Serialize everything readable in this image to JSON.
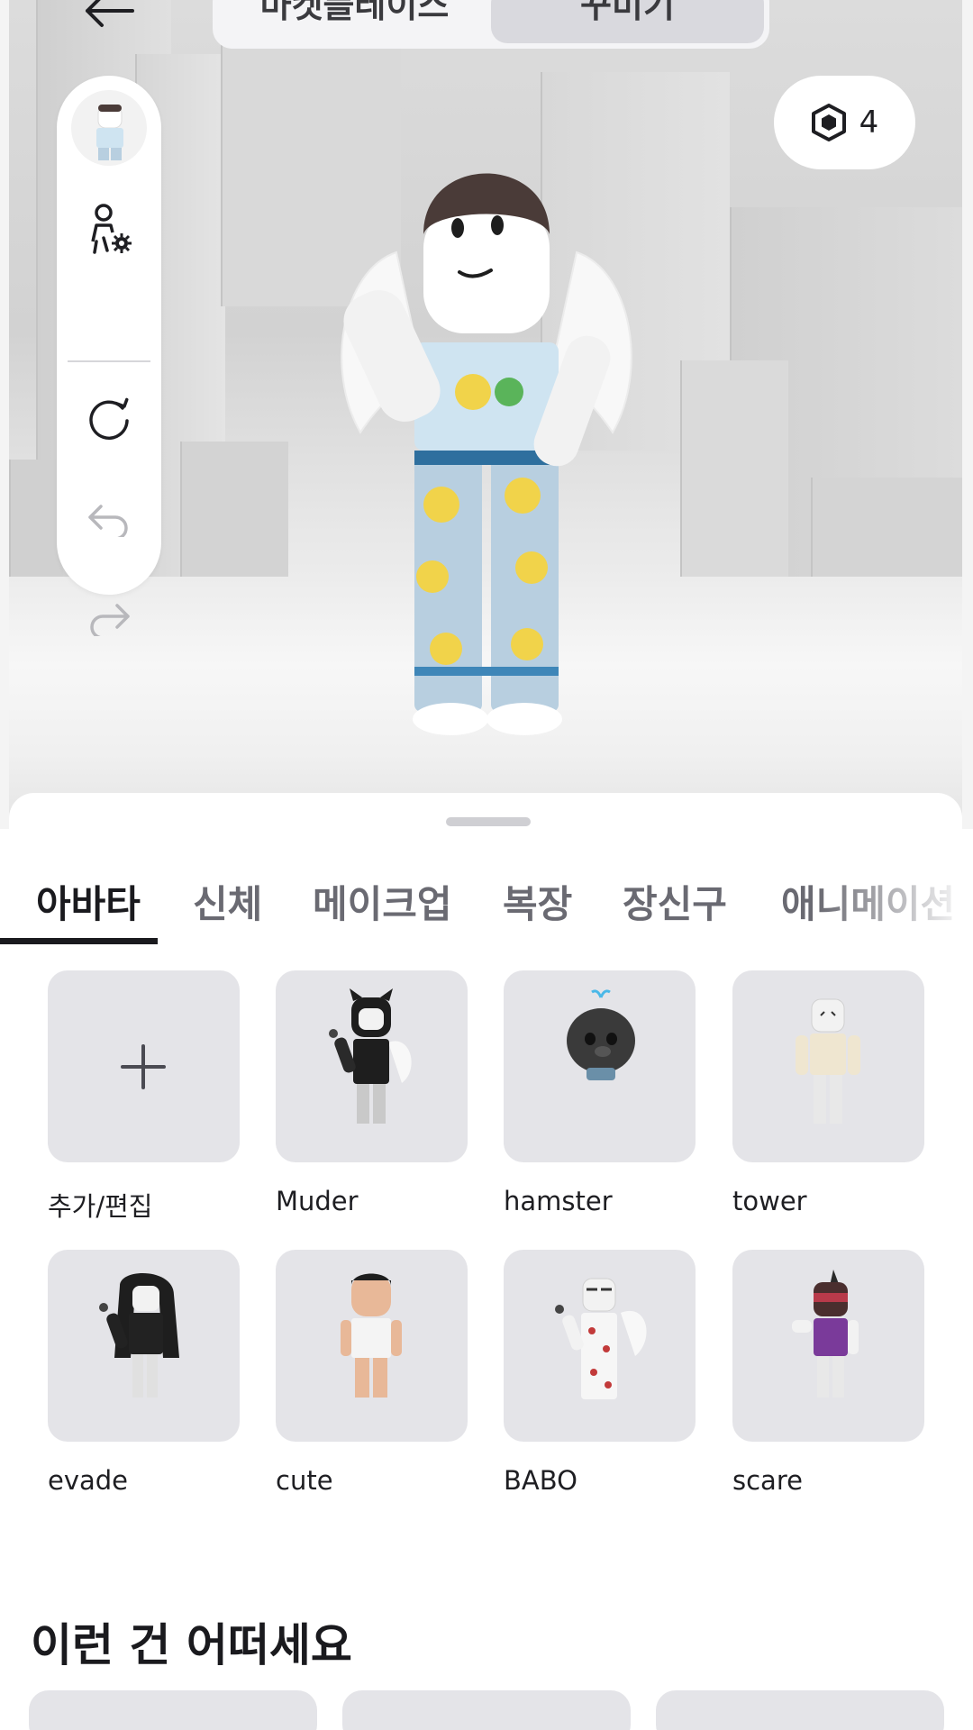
{
  "header": {
    "back_icon": "arrow-left-icon",
    "segments": [
      {
        "label": "마켓플레이스",
        "active": false
      },
      {
        "label": "꾸미기",
        "active": true
      }
    ]
  },
  "toolbar": {
    "icons": [
      "avatar-thumbnail",
      "avatar-settings-icon",
      "refresh-icon",
      "undo-icon",
      "redo-icon"
    ]
  },
  "currency": {
    "icon": "robux-icon",
    "amount": "4"
  },
  "tabs": [
    {
      "label": "아바타",
      "active": true
    },
    {
      "label": "신체",
      "active": false
    },
    {
      "label": "메이크업",
      "active": false
    },
    {
      "label": "복장",
      "active": false
    },
    {
      "label": "장신구",
      "active": false
    },
    {
      "label": "애니메이션",
      "active": false
    }
  ],
  "outfits": [
    {
      "label": "추가/편집",
      "kind": "add"
    },
    {
      "label": "Muder",
      "kind": "avatar"
    },
    {
      "label": "hamster",
      "kind": "avatar"
    },
    {
      "label": "tower",
      "kind": "avatar"
    },
    {
      "label": "evade",
      "kind": "avatar"
    },
    {
      "label": "cute",
      "kind": "avatar"
    },
    {
      "label": "BABO",
      "kind": "avatar"
    },
    {
      "label": "scare",
      "kind": "avatar"
    }
  ],
  "recommend": {
    "title": "이런 건 어떠세요"
  },
  "colors": {
    "accent": "#1a1a1e",
    "tile_bg": "#e4e4e8",
    "tab_inactive": "#6a6a72"
  }
}
